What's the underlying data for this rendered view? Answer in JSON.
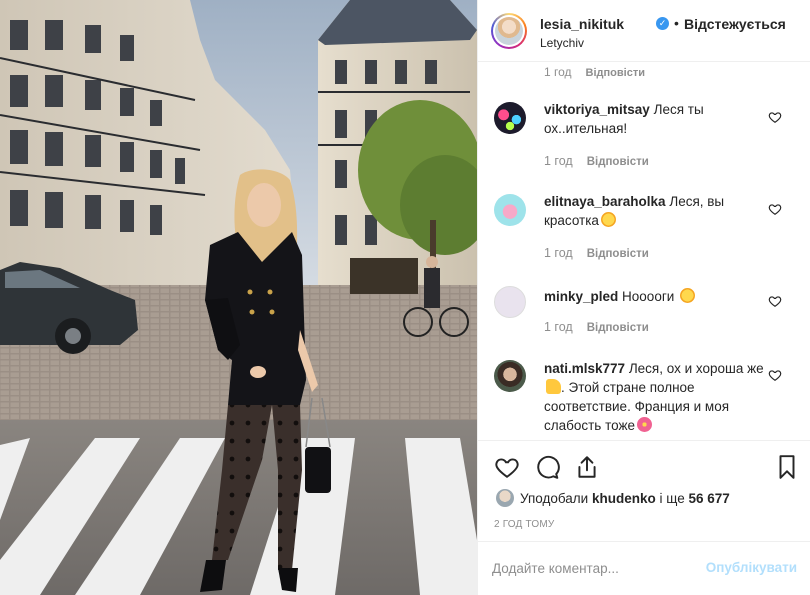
{
  "header": {
    "username": "lesia_nikituk",
    "separator": "•",
    "follow_label": "Відстежується",
    "location": "Letychiv"
  },
  "comments_top_meta": {
    "time": "1 год",
    "reply": "Відповісти"
  },
  "comments": [
    {
      "username": "viktoriya_mitsay",
      "text": "Леся ты ох..ительная!",
      "emoji": "",
      "time": "1 год",
      "reply": "Відповісти",
      "avatar_icon": "colorful-lights-avatar"
    },
    {
      "username": "elitnaya_baraholka",
      "text": "Леся, вы красотка",
      "emoji": "star-struck-emoji",
      "time": "1 год",
      "reply": "Відповісти",
      "avatar_icon": "pink-drink-avatar"
    },
    {
      "username": "minky_pled",
      "text": "Нооооги",
      "emoji": "star-struck-emoji",
      "time": "1 год",
      "reply": "Відповісти",
      "avatar_icon": "minky-logo-avatar"
    },
    {
      "username": "nati.mlsk777",
      "text": "Леся, ох и хороша же",
      "text_after_emoji": ". Этой стране полное соответствие. Франция и моя слабость тоже",
      "emoji": "thumbs-up-emoji",
      "emoji_end": "blossom-emoji",
      "avatar_icon": "woman-portrait-avatar"
    }
  ],
  "actions": {
    "like_icon": "heart-icon",
    "comment_icon": "comment-bubble-icon",
    "share_icon": "share-icon",
    "save_icon": "bookmark-icon"
  },
  "likes": {
    "prefix": "Уподобали",
    "user": "khudenko",
    "middle": "і ще",
    "count": "56 677"
  },
  "time_ago": "2 ГОД ТОМУ",
  "comment_form": {
    "placeholder": "Додайте коментар...",
    "publish_label": "Опублікувати"
  },
  "colors": {
    "accent_blue": "#3897f0",
    "publish_disabled": "#b2dffc",
    "text": "#262626",
    "muted": "#8e8e8e",
    "divider": "#efefef"
  }
}
